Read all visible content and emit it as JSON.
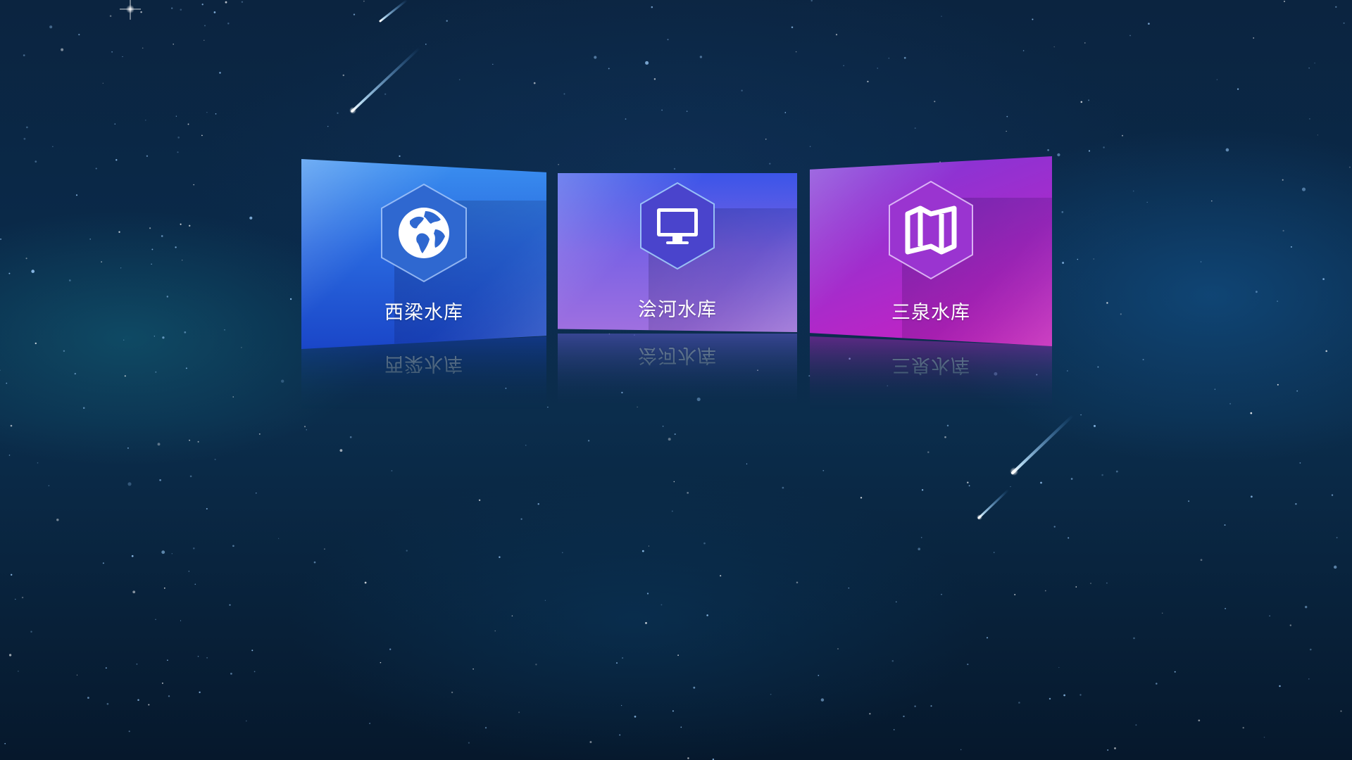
{
  "page": {
    "background_color": "#0a2440"
  },
  "reservoirs": [
    {
      "title": "西梁水库",
      "icon": "globe-icon",
      "colors": {
        "top": "#3a8ff0",
        "bottom": "#1a46c8"
      }
    },
    {
      "title": "浍河水库",
      "icon": "monitor-icon",
      "colors": {
        "top": "#3b55e8",
        "bottom": "#a070e0"
      }
    },
    {
      "title": "三泉水库",
      "icon": "map-icon",
      "colors": {
        "top": "#7a38d8",
        "bottom": "#d01ec0"
      }
    }
  ]
}
